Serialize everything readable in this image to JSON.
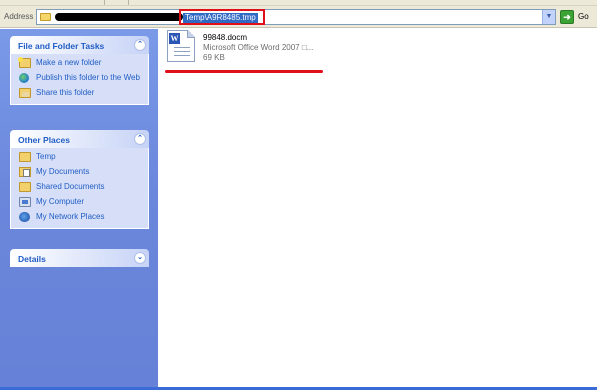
{
  "address_bar": {
    "label": "Address",
    "path_selected": "Temp\\A9R8485.tmp",
    "go_label": "Go"
  },
  "tasks_panel": {
    "title": "File and Folder Tasks",
    "items": [
      {
        "label": "Make a new folder",
        "icon": "new-folder-icon"
      },
      {
        "label": "Publish this folder to the Web",
        "icon": "globe-icon"
      },
      {
        "label": "Share this folder",
        "icon": "share-folder-icon"
      }
    ]
  },
  "places_panel": {
    "title": "Other Places",
    "items": [
      {
        "label": "Temp",
        "icon": "folder-icon"
      },
      {
        "label": "My Documents",
        "icon": "my-documents-icon"
      },
      {
        "label": "Shared Documents",
        "icon": "folder-icon"
      },
      {
        "label": "My Computer",
        "icon": "my-computer-icon"
      },
      {
        "label": "My Network Places",
        "icon": "network-places-icon"
      }
    ]
  },
  "details_panel": {
    "title": "Details"
  },
  "files": [
    {
      "name": "99848.docm",
      "type": "Microsoft Office Word 2007 □...",
      "size": "69 KB",
      "icon": "word-document-icon"
    }
  ],
  "colors": {
    "task_pane": "#6b87dc",
    "link": "#215dc6",
    "highlight": "#316ac5",
    "annotation_red": "#e0101a"
  }
}
